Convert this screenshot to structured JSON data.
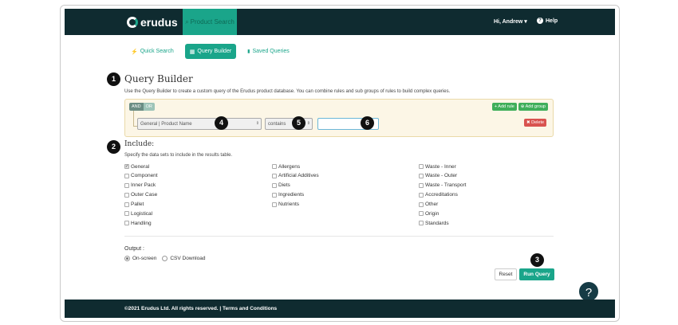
{
  "brand": {
    "name": "erudus",
    "logo_icon": "erudus-logo-icon"
  },
  "nav": {
    "active_item": "Product Search",
    "active_icon": "search-icon",
    "user_greeting": "Hi, Andrew",
    "user_caret": "▾",
    "help_label": "Help",
    "help_icon": "question-circle-icon"
  },
  "tabs": [
    {
      "label": "Quick Search",
      "icon": "bolt-icon",
      "glyph": "⚡"
    },
    {
      "label": "Query Builder",
      "icon": "grid-icon",
      "glyph": "▦"
    },
    {
      "label": "Saved Queries",
      "icon": "bookmark-icon",
      "glyph": "🔖"
    }
  ],
  "query_builder": {
    "title": "Query Builder",
    "description": "Use the Query Builder to create a custom query of the Erudus product database. You can combine rules and sub groups of rules to build complex queries.",
    "and_label": "AND",
    "or_label": "OR",
    "add_rule_label": "+ Add rule",
    "add_group_label": "⊕ Add group",
    "field_select_value": "General | Product Name",
    "operator_select_value": "contains",
    "value_input": "",
    "delete_label": "✖ Delete"
  },
  "include": {
    "title": "Include:",
    "description": "Specify the data sets to include in the results table.",
    "columns": [
      [
        {
          "label": "General",
          "checked": true
        },
        {
          "label": "Component",
          "checked": false
        },
        {
          "label": "Inner Pack",
          "checked": false
        },
        {
          "label": "Outer Case",
          "checked": false
        },
        {
          "label": "Pallet",
          "checked": false
        },
        {
          "label": "Logistical",
          "checked": false
        },
        {
          "label": "Handling",
          "checked": false
        }
      ],
      [
        {
          "label": "Allergens",
          "checked": false
        },
        {
          "label": "Artificial Additives",
          "checked": false
        },
        {
          "label": "Diets",
          "checked": false
        },
        {
          "label": "Ingredients",
          "checked": false
        },
        {
          "label": "Nutrients",
          "checked": false
        }
      ],
      [
        {
          "label": "Waste - Inner",
          "checked": false
        },
        {
          "label": "Waste - Outer",
          "checked": false
        },
        {
          "label": "Waste - Transport",
          "checked": false
        },
        {
          "label": "Accreditations",
          "checked": false
        },
        {
          "label": "Other",
          "checked": false
        },
        {
          "label": "Origin",
          "checked": false
        },
        {
          "label": "Standards",
          "checked": false
        }
      ]
    ]
  },
  "output": {
    "label": "Output :",
    "options": [
      {
        "label": "On-screen",
        "selected": true
      },
      {
        "label": "CSV Download",
        "selected": false
      }
    ]
  },
  "actions": {
    "reset_label": "Reset",
    "run_label": "Run Query"
  },
  "help_fab": "?",
  "footer": {
    "text": "©2021 Erudus Ltd. All rights reserved. | Terms and Conditions"
  },
  "callouts": [
    "1",
    "2",
    "3",
    "4",
    "5",
    "6"
  ],
  "colors": {
    "navbar": "#0f2b30",
    "accent": "#1aa58a",
    "delete": "#d9534f",
    "add": "#3fae5a",
    "panel": "#fcf6e6"
  }
}
